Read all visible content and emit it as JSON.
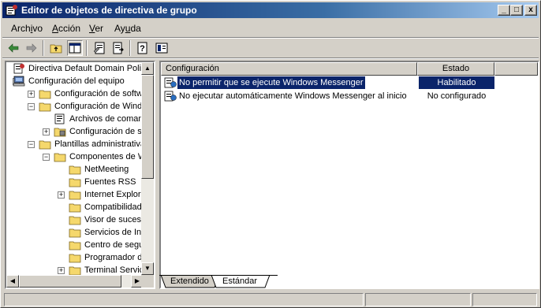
{
  "window": {
    "title": "Editor de objetos de directiva de grupo",
    "controls": [
      "_",
      "□",
      "x"
    ]
  },
  "menu": [
    {
      "label": "Archivo",
      "accel_index": 4
    },
    {
      "label": "Acción",
      "accel_index": 0
    },
    {
      "label": "Ver",
      "accel_index": 0
    },
    {
      "label": "Ayuda",
      "accel_index": 2
    }
  ],
  "toolbar": {
    "icons": [
      "back-arrow-icon",
      "forward-arrow-icon",
      "up-folder-icon",
      "show-hide-tree-icon",
      "properties-icon",
      "export-list-icon",
      "help-icon",
      "extended-view-icon"
    ]
  },
  "tree": {
    "items": [
      {
        "label": "Directiva Default Domain Policy",
        "level": 0,
        "icon": "policy-icon",
        "expander": ""
      },
      {
        "label": "Configuración del equipo",
        "level": 0,
        "icon": "computer-icon",
        "expander": "-"
      },
      {
        "label": "Configuración de software",
        "level": 1,
        "icon": "folder-icon",
        "expander": "+"
      },
      {
        "label": "Configuración de Windows",
        "level": 1,
        "icon": "folder-icon",
        "expander": "-"
      },
      {
        "label": "Archivos de comandos",
        "level": 2,
        "icon": "script-icon",
        "expander": ""
      },
      {
        "label": "Configuración de seguridad",
        "level": 2,
        "icon": "security-icon",
        "expander": "+"
      },
      {
        "label": "Plantillas administrativas",
        "level": 1,
        "icon": "folder-icon",
        "expander": "-"
      },
      {
        "label": "Componentes de Windows",
        "level": 2,
        "icon": "folder-icon",
        "expander": "-"
      },
      {
        "label": "NetMeeting",
        "level": 3,
        "icon": "folder-icon",
        "expander": ""
      },
      {
        "label": "Fuentes RSS",
        "level": 3,
        "icon": "folder-icon",
        "expander": ""
      },
      {
        "label": "Internet Explorer",
        "level": 3,
        "icon": "folder-icon",
        "expander": "+"
      },
      {
        "label": "Compatibilidad de aplicaciones",
        "level": 3,
        "icon": "folder-icon",
        "expander": ""
      },
      {
        "label": "Visor de sucesos",
        "level": 3,
        "icon": "folder-icon",
        "expander": ""
      },
      {
        "label": "Servicios de Internet Information Server",
        "level": 3,
        "icon": "folder-icon",
        "expander": ""
      },
      {
        "label": "Centro de seguridad",
        "level": 3,
        "icon": "folder-icon",
        "expander": ""
      },
      {
        "label": "Programador de tareas",
        "level": 3,
        "icon": "folder-icon",
        "expander": ""
      },
      {
        "label": "Terminal Services",
        "level": 3,
        "icon": "folder-icon",
        "expander": "+"
      }
    ]
  },
  "list": {
    "columns": [
      "Configuración",
      "Estado"
    ],
    "rows": [
      {
        "name": "No permitir que se ejecute Windows Messenger",
        "state": "Habilitado",
        "selected": true
      },
      {
        "name": "No ejecutar automáticamente Windows Messenger al inicio",
        "state": "No configurado",
        "selected": false
      }
    ]
  },
  "tabs": [
    {
      "label": "Extendido",
      "active": false
    },
    {
      "label": "Estándar",
      "active": true
    }
  ],
  "colors": {
    "selection": "#0a246a",
    "titlebar_start": "#0a246a",
    "titlebar_end": "#a6caf0",
    "folder": "#f5d86c"
  }
}
